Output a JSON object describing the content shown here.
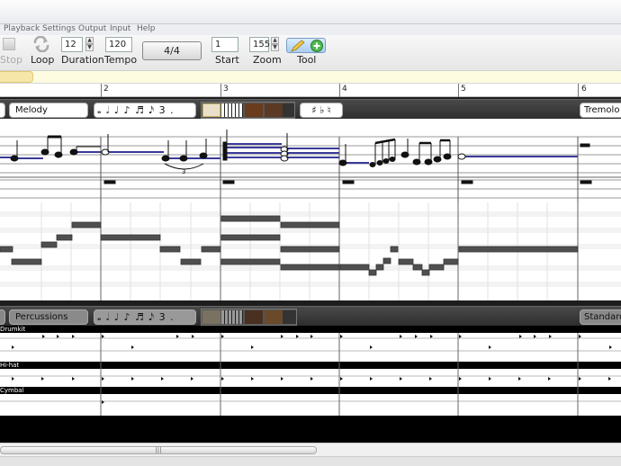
{
  "menu": [
    "Playback",
    "Settings",
    "Output",
    "Input",
    "Help"
  ],
  "toolbar": {
    "stop_label": "Stop",
    "loop_label": "Loop",
    "duration_label": "Duration",
    "duration_value": "12",
    "tempo_label": "Tempo",
    "tempo_value": "120",
    "time_signature": "4/4",
    "start_label": "Start",
    "start_value": "1",
    "zoom_label": "Zoom",
    "zoom_value": "155",
    "tool_label": "Tool"
  },
  "timeline": {
    "measures": [
      "2",
      "3",
      "4",
      "5",
      "6"
    ]
  },
  "tracks": [
    {
      "name": "Melody",
      "duration_symbols": "𝅝 𝅗𝅥 ♩ ♪ ♬ 𝅘𝅥𝅯 3 .",
      "accidentals": "♯ ♭ ♮",
      "instrument": "Tremolo Strings"
    },
    {
      "name": "Percussions",
      "duration_symbols": "𝅝 𝅗𝅥 ♩ ♪ ♬ 𝅘𝅥𝅯 3 .",
      "kit": "Standard",
      "drums": [
        "Drumkit",
        "Hi-hat",
        "Cymbal"
      ]
    }
  ],
  "colors": {
    "accent_blue": "#3a3a9a",
    "note_gray": "#4f4f4f",
    "header_dark": "#2c2c2c"
  }
}
